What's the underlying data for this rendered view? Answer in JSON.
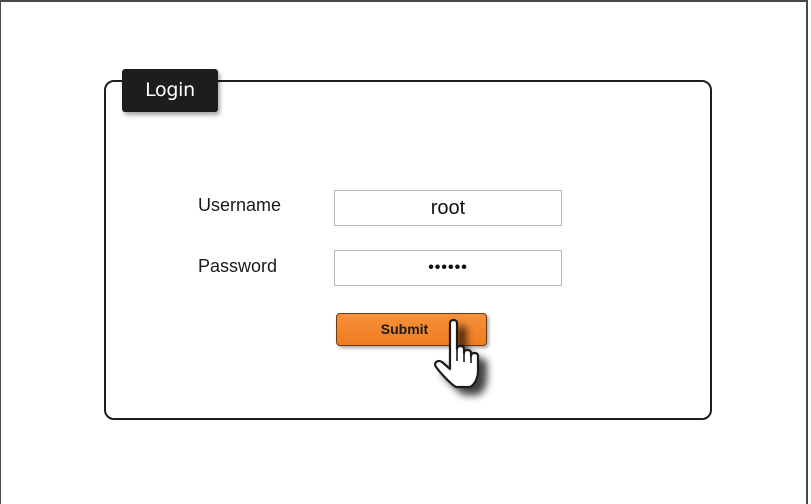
{
  "login": {
    "title": "Login",
    "username_label": "Username",
    "username_value": "root",
    "password_label": "Password",
    "password_value": "••••••",
    "submit_label": "Submit"
  },
  "colors": {
    "submit_button": "#f08226",
    "tab_background": "#1d1d1d",
    "border": "#1e1e1e"
  },
  "icons": {
    "cursor": "hand-pointer-icon"
  }
}
